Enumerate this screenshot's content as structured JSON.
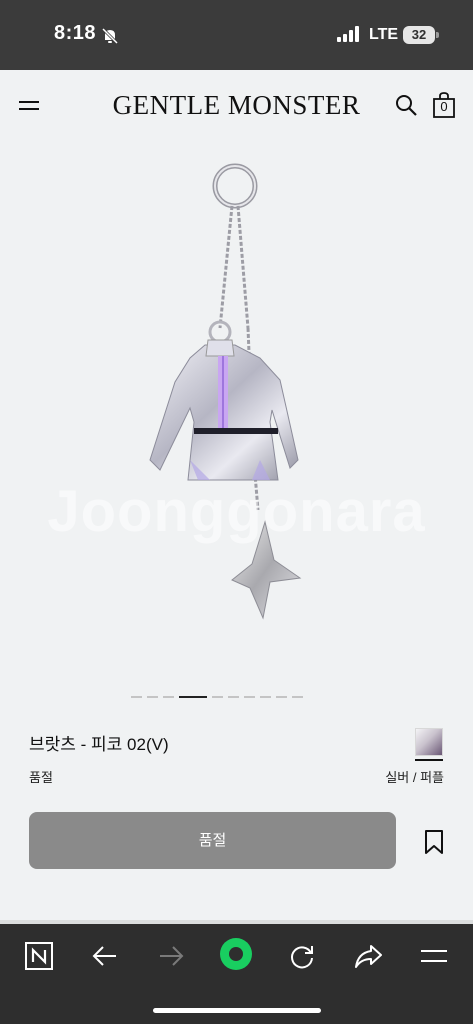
{
  "status_bar": {
    "time": "8:18",
    "network": "LTE",
    "battery": "32",
    "icons": [
      "bell-slash-icon",
      "signal-icon",
      "battery-icon"
    ]
  },
  "header": {
    "brand": "GENTLE MONSTER",
    "bag_count": "0",
    "icons": [
      "menu-icon",
      "search-icon",
      "bag-icon"
    ]
  },
  "gallery": {
    "watermark": "Joonggonara",
    "dots_total": 10,
    "active_index": 3
  },
  "product": {
    "name": "브랏츠 - 피코 02(V)",
    "status": "품절",
    "color_label": "실버 / 퍼플"
  },
  "actions": {
    "soldout_label": "품절",
    "bookmark_icon": "bookmark-icon"
  },
  "toolbar": {
    "icons": [
      "naver-n-icon",
      "back-arrow-icon",
      "forward-arrow-icon",
      "green-circle-icon",
      "refresh-icon",
      "share-icon",
      "hamburger-menu-icon"
    ]
  },
  "colors": {
    "status_bar_bg": "#3b3b3b",
    "page_bg": "#f0f2f3",
    "button_bg": "#8a8a8a",
    "toolbar_bg": "#2e2e2e",
    "accent_green": "#19ce60"
  }
}
